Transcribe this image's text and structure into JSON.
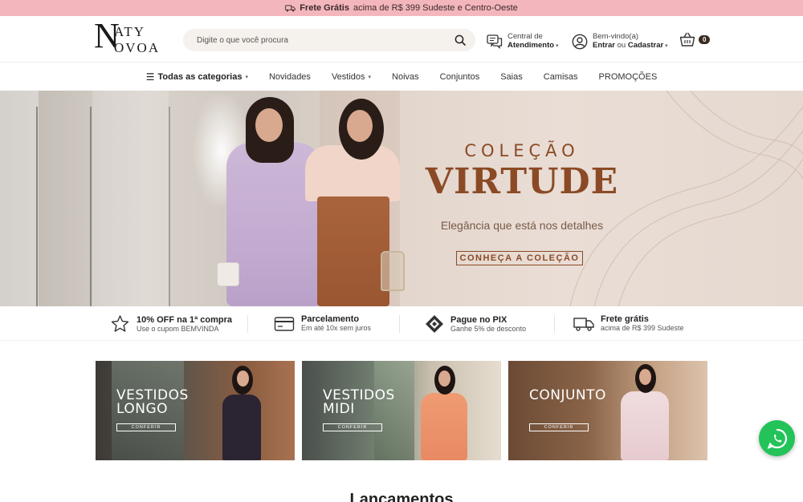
{
  "topbar": {
    "bold": "Frete Grátis",
    "text": "acima de R$ 399 Sudeste e Centro-Oeste"
  },
  "header": {
    "logo": {
      "line1": "ATY",
      "line2": "OVOA",
      "initial": "N"
    },
    "search": {
      "placeholder": "Digite o que você procura"
    },
    "service": {
      "line1": "Central de",
      "line2": "Atendimento"
    },
    "account": {
      "line1": "Bem-vindo(a)",
      "enter": "Entrar",
      "or": "ou",
      "register": "Cadastrar"
    },
    "cart": {
      "count": "0"
    }
  },
  "nav": {
    "all": "Todas as categorias",
    "items": [
      "Novidades",
      "Vestidos",
      "Noivas",
      "Conjuntos",
      "Saias",
      "Camisas",
      "PROMOÇÕES"
    ]
  },
  "hero": {
    "kicker": "COLEÇÃO",
    "title": "VIRTUDE",
    "subtitle": "Elegância que está nos detalhes",
    "cta": "CONHEÇA A COLEÇÃO"
  },
  "benefits": [
    {
      "title": "10% OFF na 1ª compra",
      "sub": "Use o cupom BEMVINDA",
      "icon": "star-icon"
    },
    {
      "title": "Parcelamento",
      "sub": "Em até 10x sem juros",
      "icon": "card-icon"
    },
    {
      "title": "Pague no PIX",
      "sub": "Ganhe 5% de desconto",
      "icon": "pix-icon"
    },
    {
      "title": "Frete grátis",
      "sub": "acima de R$ 399 Sudeste",
      "icon": "truck-icon"
    }
  ],
  "categories": [
    {
      "line1": "VESTIDOS",
      "line2": "LONGO",
      "button": "CONFERIR"
    },
    {
      "line1": "VESTIDOS",
      "line2": "MIDI",
      "button": "CONFERIR"
    },
    {
      "line1": "CONJUNTO",
      "line2": "",
      "button": "CONFERIR"
    }
  ],
  "section": {
    "title": "Lançamentos"
  },
  "colors": {
    "topbar": "#f4b6bd",
    "accent": "#8b4a25",
    "whatsapp": "#24c35a"
  }
}
